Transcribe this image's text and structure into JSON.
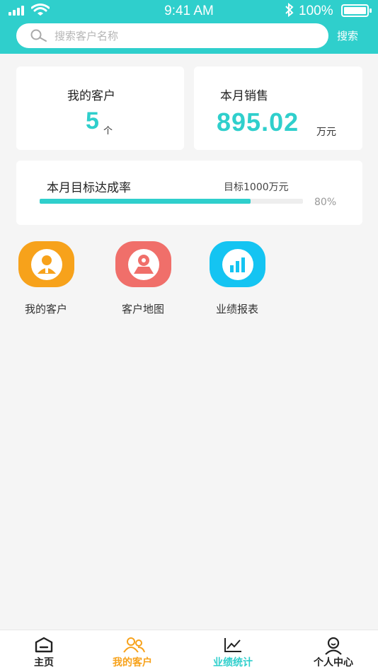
{
  "status_bar": {
    "time": "9:41 AM",
    "battery": "100%"
  },
  "search": {
    "placeholder": "搜索客户名称",
    "button_label": "搜索"
  },
  "stats": {
    "customers": {
      "title": "我的客户",
      "value": "5",
      "unit": "个"
    },
    "sales": {
      "title": "本月销售",
      "value": "895.02",
      "unit": "万元"
    }
  },
  "goal": {
    "title": "本月目标达成率",
    "target": "目标1000万元",
    "percent_label": "80%",
    "percent": 80
  },
  "entries": [
    {
      "label": "我的客户",
      "icon": "customer-icon",
      "color": "#f7a21b"
    },
    {
      "label": "客户地图",
      "icon": "map-pin-icon",
      "color": "#f06f6a"
    },
    {
      "label": "业绩报表",
      "icon": "bar-chart-icon",
      "color": "#14c4f2"
    }
  ],
  "tabs": [
    {
      "label": "主页",
      "icon": "home-icon",
      "color": "#222222"
    },
    {
      "label": "我的客户",
      "icon": "users-icon",
      "color": "#f7a21b"
    },
    {
      "label": "业绩统计",
      "icon": "line-chart-icon",
      "color": "#2fcfcc"
    },
    {
      "label": "个人中心",
      "icon": "user-icon",
      "color": "#222222"
    }
  ],
  "colors": {
    "primary": "#2fcfcc",
    "accent_orange": "#f7a21b",
    "background": "#f5f5f5"
  }
}
